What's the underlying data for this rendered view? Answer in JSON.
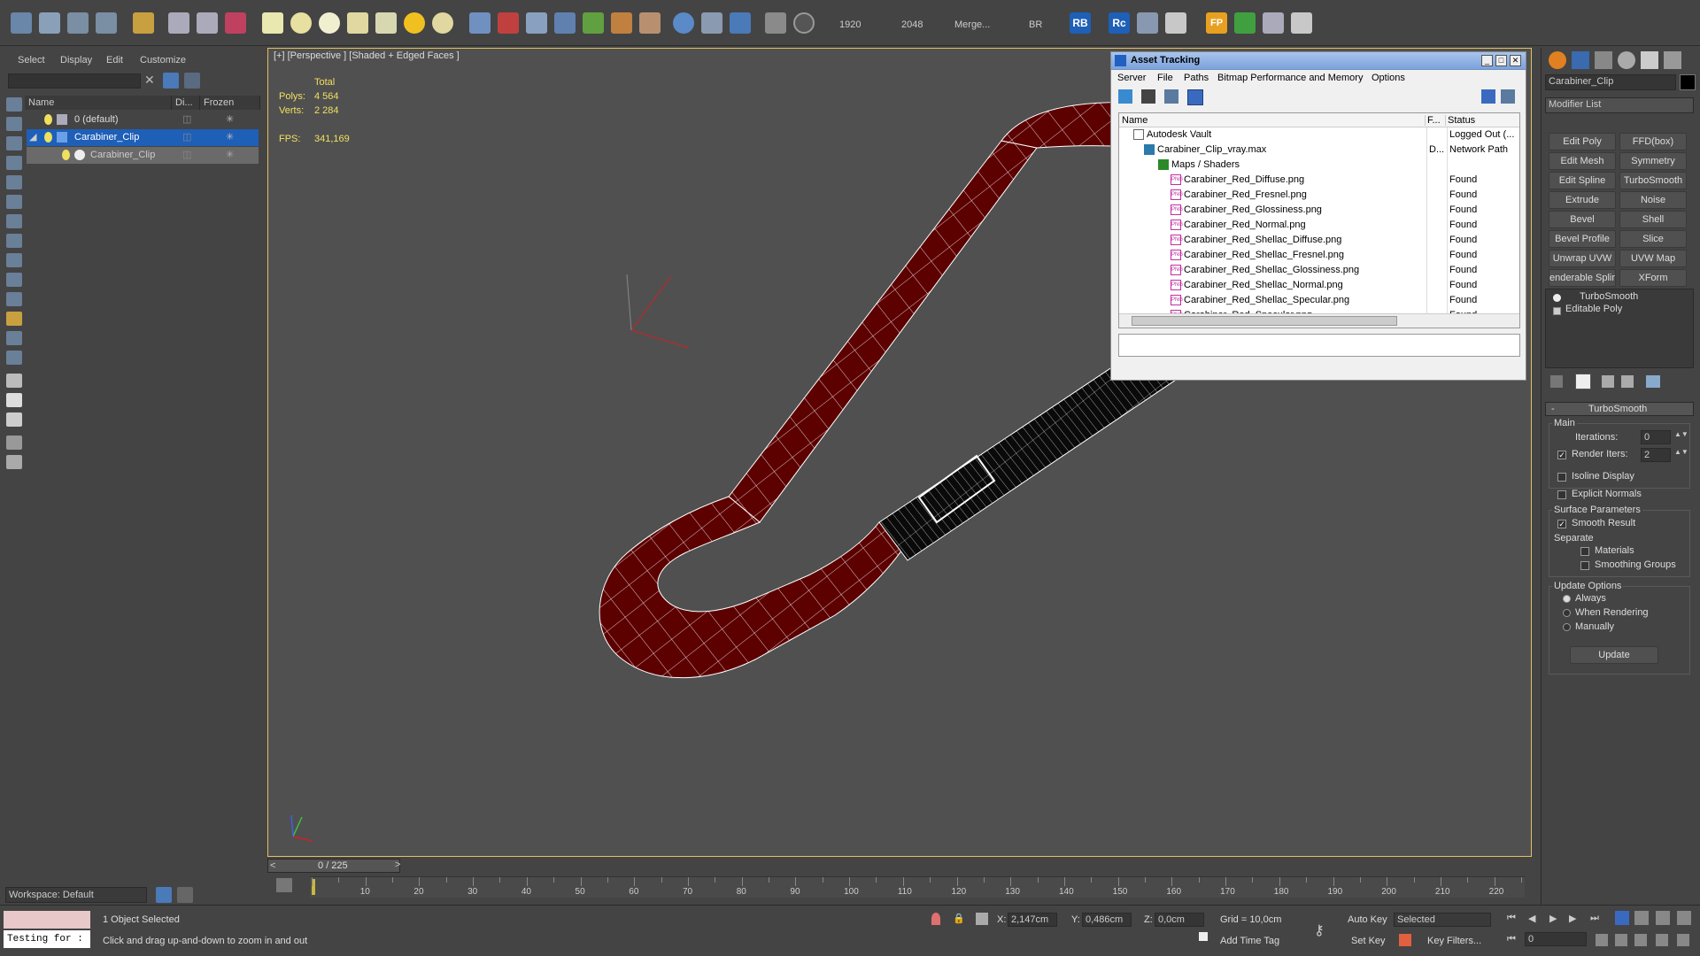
{
  "toolbar": {
    "render_width": "1920",
    "render_height": "2048",
    "merge_label": "Merge...",
    "br_label": "BR",
    "rb_label": "RB",
    "rc_label": "Rc",
    "fp_label": "FP"
  },
  "scene_explorer": {
    "menu": [
      "Select",
      "Display",
      "Edit",
      "Customize"
    ],
    "columns": {
      "name": "Name",
      "display": "Di...",
      "frozen": "Frozen"
    },
    "rows": [
      {
        "label": "0 (default)"
      },
      {
        "label": "Carabiner_Clip"
      },
      {
        "label": "Carabiner_Clip"
      }
    ],
    "workspace": "Workspace: Default"
  },
  "viewport": {
    "label": "[+] [Perspective ] [Shaded + Edged Faces ]",
    "stats_total": "Total",
    "polys_label": "Polys:",
    "polys_value": "4 564",
    "verts_label": "Verts:",
    "verts_value": "2 284",
    "fps_label": "FPS:",
    "fps_value": "341,169"
  },
  "asset_tracking": {
    "title": "Asset Tracking",
    "menu": [
      "Server",
      "File",
      "Paths",
      "Bitmap Performance and Memory",
      "Options"
    ],
    "col_name": "Name",
    "col_f": "F...",
    "col_status": "Status",
    "rows": [
      {
        "name": "Autodesk Vault",
        "f": "",
        "status": "Logged Out (..."
      },
      {
        "name": "Carabiner_Clip_vray.max",
        "f": "D...",
        "status": "Network Path"
      },
      {
        "name": "Maps / Shaders",
        "f": "",
        "status": ""
      },
      {
        "name": "Carabiner_Red_Diffuse.png",
        "f": "",
        "status": "Found"
      },
      {
        "name": "Carabiner_Red_Fresnel.png",
        "f": "",
        "status": "Found"
      },
      {
        "name": "Carabiner_Red_Glossiness.png",
        "f": "",
        "status": "Found"
      },
      {
        "name": "Carabiner_Red_Normal.png",
        "f": "",
        "status": "Found"
      },
      {
        "name": "Carabiner_Red_Shellac_Diffuse.png",
        "f": "",
        "status": "Found"
      },
      {
        "name": "Carabiner_Red_Shellac_Fresnel.png",
        "f": "",
        "status": "Found"
      },
      {
        "name": "Carabiner_Red_Shellac_Glossiness.png",
        "f": "",
        "status": "Found"
      },
      {
        "name": "Carabiner_Red_Shellac_Normal.png",
        "f": "",
        "status": "Found"
      },
      {
        "name": "Carabiner_Red_Shellac_Specular.png",
        "f": "",
        "status": "Found"
      },
      {
        "name": "Carabiner_Red_Specular.png",
        "f": "",
        "status": "Found"
      }
    ]
  },
  "command_panel": {
    "object_name": "Carabiner_Clip",
    "modifier_list": "Modifier List",
    "buttons": [
      "Edit Poly",
      "FFD(box)",
      "Edit Mesh",
      "Symmetry",
      "Edit Spline",
      "TurboSmooth",
      "Extrude",
      "Noise",
      "Bevel",
      "Shell",
      "Bevel Profile",
      "Slice",
      "Unwrap UVW",
      "UVW Map",
      "enderable Splir",
      "XForm"
    ],
    "stack": [
      "TurboSmooth",
      "Editable Poly"
    ],
    "rollout_title": "TurboSmooth",
    "main_label": "Main",
    "iterations_label": "Iterations:",
    "iterations_value": "0",
    "render_iters_label": "Render Iters:",
    "render_iters_value": "2",
    "isoline": "Isoline Display",
    "explicit_normals": "Explicit Normals",
    "surface_params": "Surface Parameters",
    "smooth_result": "Smooth Result",
    "separate": "Separate",
    "materials": "Materials",
    "smoothing_groups": "Smoothing Groups",
    "update_options": "Update Options",
    "always": "Always",
    "when_rendering": "When Rendering",
    "manually": "Manually",
    "update_btn": "Update"
  },
  "timeline": {
    "frame_counter": "0 / 225",
    "ticks": [
      "10",
      "20",
      "30",
      "40",
      "50",
      "60",
      "70",
      "80",
      "90",
      "100",
      "110",
      "120",
      "130",
      "140",
      "150",
      "160",
      "170",
      "180",
      "190",
      "200",
      "210",
      "220"
    ]
  },
  "status_bar": {
    "maxscript": "Testing for :",
    "selection": "1 Object Selected",
    "prompt": "Click and drag up-and-down to zoom in and out",
    "x_label": "X:",
    "x_value": "2,147cm",
    "y_label": "Y:",
    "y_value": "0,486cm",
    "z_label": "Z:",
    "z_value": "0,0cm",
    "grid": "Grid = 10,0cm",
    "add_time_tag": "Add Time Tag",
    "auto_key": "Auto Key",
    "set_key": "Set Key",
    "selected": "Selected",
    "key_filters": "Key Filters...",
    "frame_value": "0"
  },
  "colors": {
    "carabiner_red": "#5c0000",
    "wire": "#ffffff",
    "viewport_bg": "#505050",
    "accent_blue": "#1e5fb8"
  }
}
